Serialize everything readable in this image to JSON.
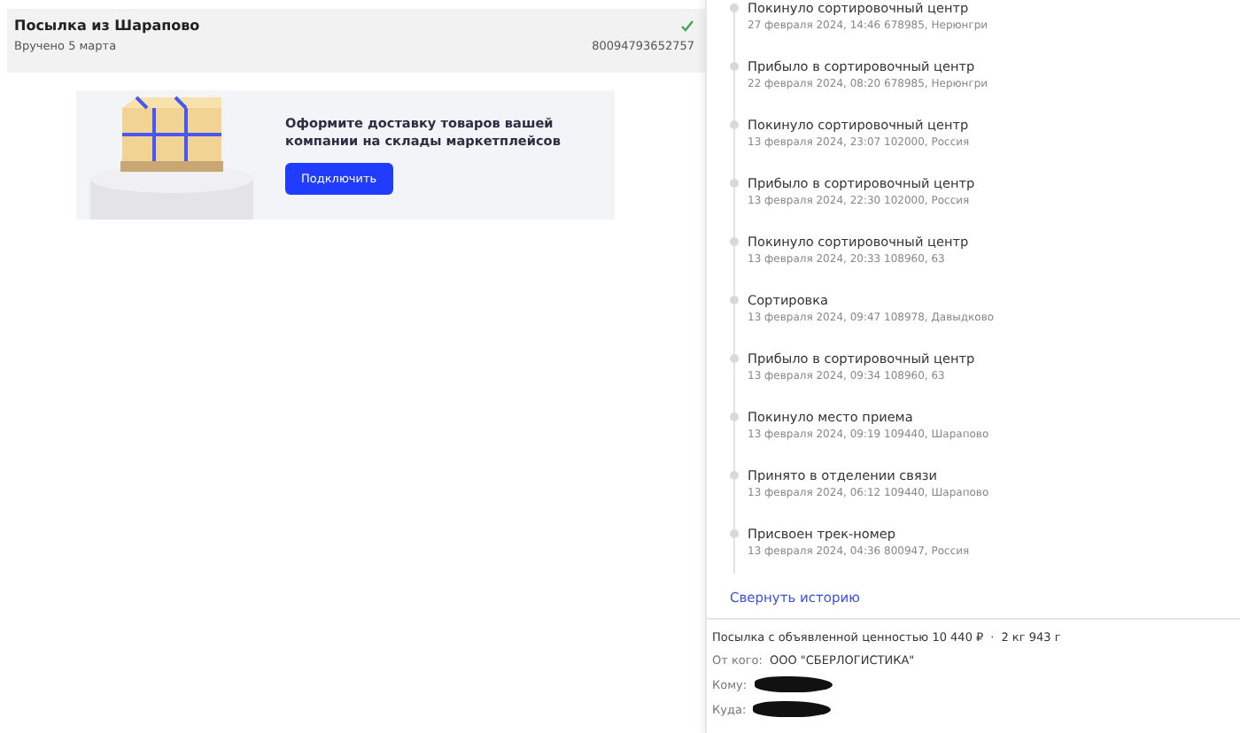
{
  "parcel": {
    "title": "Посылка из Шарапово",
    "status": "Вручено 5 марта",
    "delivered": true,
    "track": "80094793652757"
  },
  "banner": {
    "text": "Оформите доставку товаров вашей компании на склады маркетплейсов",
    "button": "Подключить"
  },
  "history": [
    {
      "title": "Покинуло сортировочный центр",
      "detail": "27 февраля 2024, 14:46 678985, Нерюнгри"
    },
    {
      "title": "Прибыло в сортировочный центр",
      "detail": "22 февраля 2024, 08:20 678985, Нерюнгри"
    },
    {
      "title": "Покинуло сортировочный центр",
      "detail": "13 февраля 2024, 23:07 102000, Россия"
    },
    {
      "title": "Прибыло в сортировочный центр",
      "detail": "13 февраля 2024, 22:30 102000, Россия"
    },
    {
      "title": "Покинуло сортировочный центр",
      "detail": "13 февраля 2024, 20:33 108960, 63"
    },
    {
      "title": "Сортировка",
      "detail": "13 февраля 2024, 09:47 108978, Давыдково"
    },
    {
      "title": "Прибыло в сортировочный центр",
      "detail": "13 февраля 2024, 09:34 108960, 63"
    },
    {
      "title": "Покинуло место приема",
      "detail": "13 февраля 2024, 09:19 109440, Шарапово"
    },
    {
      "title": "Принято в отделении связи",
      "detail": "13 февраля 2024, 06:12 109440, Шарапово"
    },
    {
      "title": "Присвоен трек-номер",
      "detail": "13 февраля 2024, 04:36 800947, Россия"
    }
  ],
  "collapse_link": "Свернуть историю",
  "details": {
    "value": "Посылка с объявленной ценностью 10 440 ₽",
    "separator": "·",
    "weight": "2 кг 943 г",
    "sender_label": "От кого:",
    "sender": "ООО \"СБЕРЛОГИСТИКА\"",
    "recipient_label": "Кому:",
    "address_label": "Куда:"
  }
}
